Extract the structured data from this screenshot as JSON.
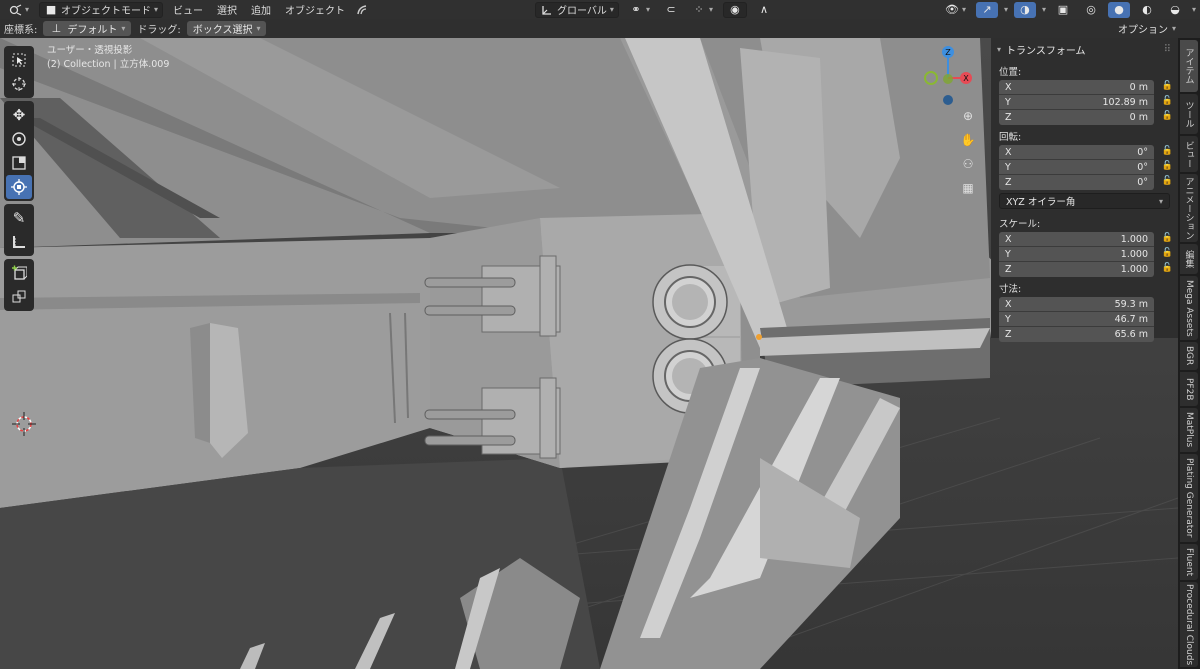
{
  "header": {
    "mode_label": "オブジェクトモード",
    "menus": [
      "ビュー",
      "選択",
      "追加",
      "オブジェクト"
    ],
    "transform_orientation": "グローバル"
  },
  "toolrow": {
    "coord_label": "座標系:",
    "coord_value": "デフォルト",
    "drag_label": "ドラッグ:",
    "drag_value": "ボックス選択",
    "options_label": "オプション"
  },
  "viewport": {
    "view_name": "ユーザー・透視投影",
    "object_info": "(2) Collection | 立方体.009"
  },
  "gizmo": {
    "axis_x": "X",
    "axis_y": "Y",
    "axis_z": "Z"
  },
  "npanel": {
    "section_title": "トランスフォーム",
    "location_label": "位置:",
    "location": [
      {
        "axis": "X",
        "value": "0 m"
      },
      {
        "axis": "Y",
        "value": "102.89 m"
      },
      {
        "axis": "Z",
        "value": "0 m"
      }
    ],
    "rotation_label": "回転:",
    "rotation": [
      {
        "axis": "X",
        "value": "0°"
      },
      {
        "axis": "Y",
        "value": "0°"
      },
      {
        "axis": "Z",
        "value": "0°"
      }
    ],
    "rotation_mode": "XYZ オイラー角",
    "scale_label": "スケール:",
    "scale": [
      {
        "axis": "X",
        "value": "1.000"
      },
      {
        "axis": "Y",
        "value": "1.000"
      },
      {
        "axis": "Z",
        "value": "1.000"
      }
    ],
    "dimensions_label": "寸法:",
    "dimensions": [
      {
        "axis": "X",
        "value": "59.3 m"
      },
      {
        "axis": "Y",
        "value": "46.7 m"
      },
      {
        "axis": "Z",
        "value": "65.6 m"
      }
    ]
  },
  "sidebar_tabs": [
    "アイテム",
    "ツール",
    "ビュー",
    "アニメーション",
    "編集",
    "Mega Assets",
    "BGR",
    "PF2B",
    "MatPlus",
    "Plating Generator",
    "Fluent",
    "Procedural Clouds"
  ],
  "colors": {
    "accent": "#4772b3",
    "x_axis": "#e64b55",
    "y_axis": "#8ab833",
    "z_axis": "#3d8fe0"
  }
}
